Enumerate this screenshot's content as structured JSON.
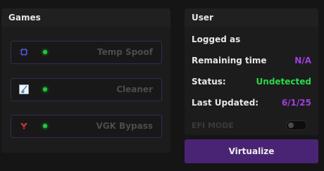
{
  "games": {
    "title": "Games",
    "items": [
      {
        "label": "Temp Spoof",
        "icon": "cpu-chip-icon",
        "status": "active",
        "status_color": "#23c93a"
      },
      {
        "label": "Cleaner",
        "icon": "broom-icon",
        "status": "active",
        "status_color": "#23c93a"
      },
      {
        "label": "VGK Bypass",
        "icon": "valorant-icon",
        "status": "active",
        "status_color": "#23c93a"
      }
    ]
  },
  "user": {
    "title": "User",
    "logged_as_label": "Logged as",
    "remaining_label": "Remaining time",
    "remaining_value": "N/A",
    "status_label": "Status:",
    "status_value": "Undetected",
    "updated_label": "Last Updated:",
    "updated_value": "6/1/25",
    "efi_label": "EFI MODE",
    "efi_enabled": false
  },
  "actions": {
    "virtualize_label": "Virtualize"
  },
  "colors": {
    "accent": "#4a2474",
    "value_purple": "#a23ee0",
    "value_green": "#29d84a",
    "row_border": "#3a2a52"
  }
}
